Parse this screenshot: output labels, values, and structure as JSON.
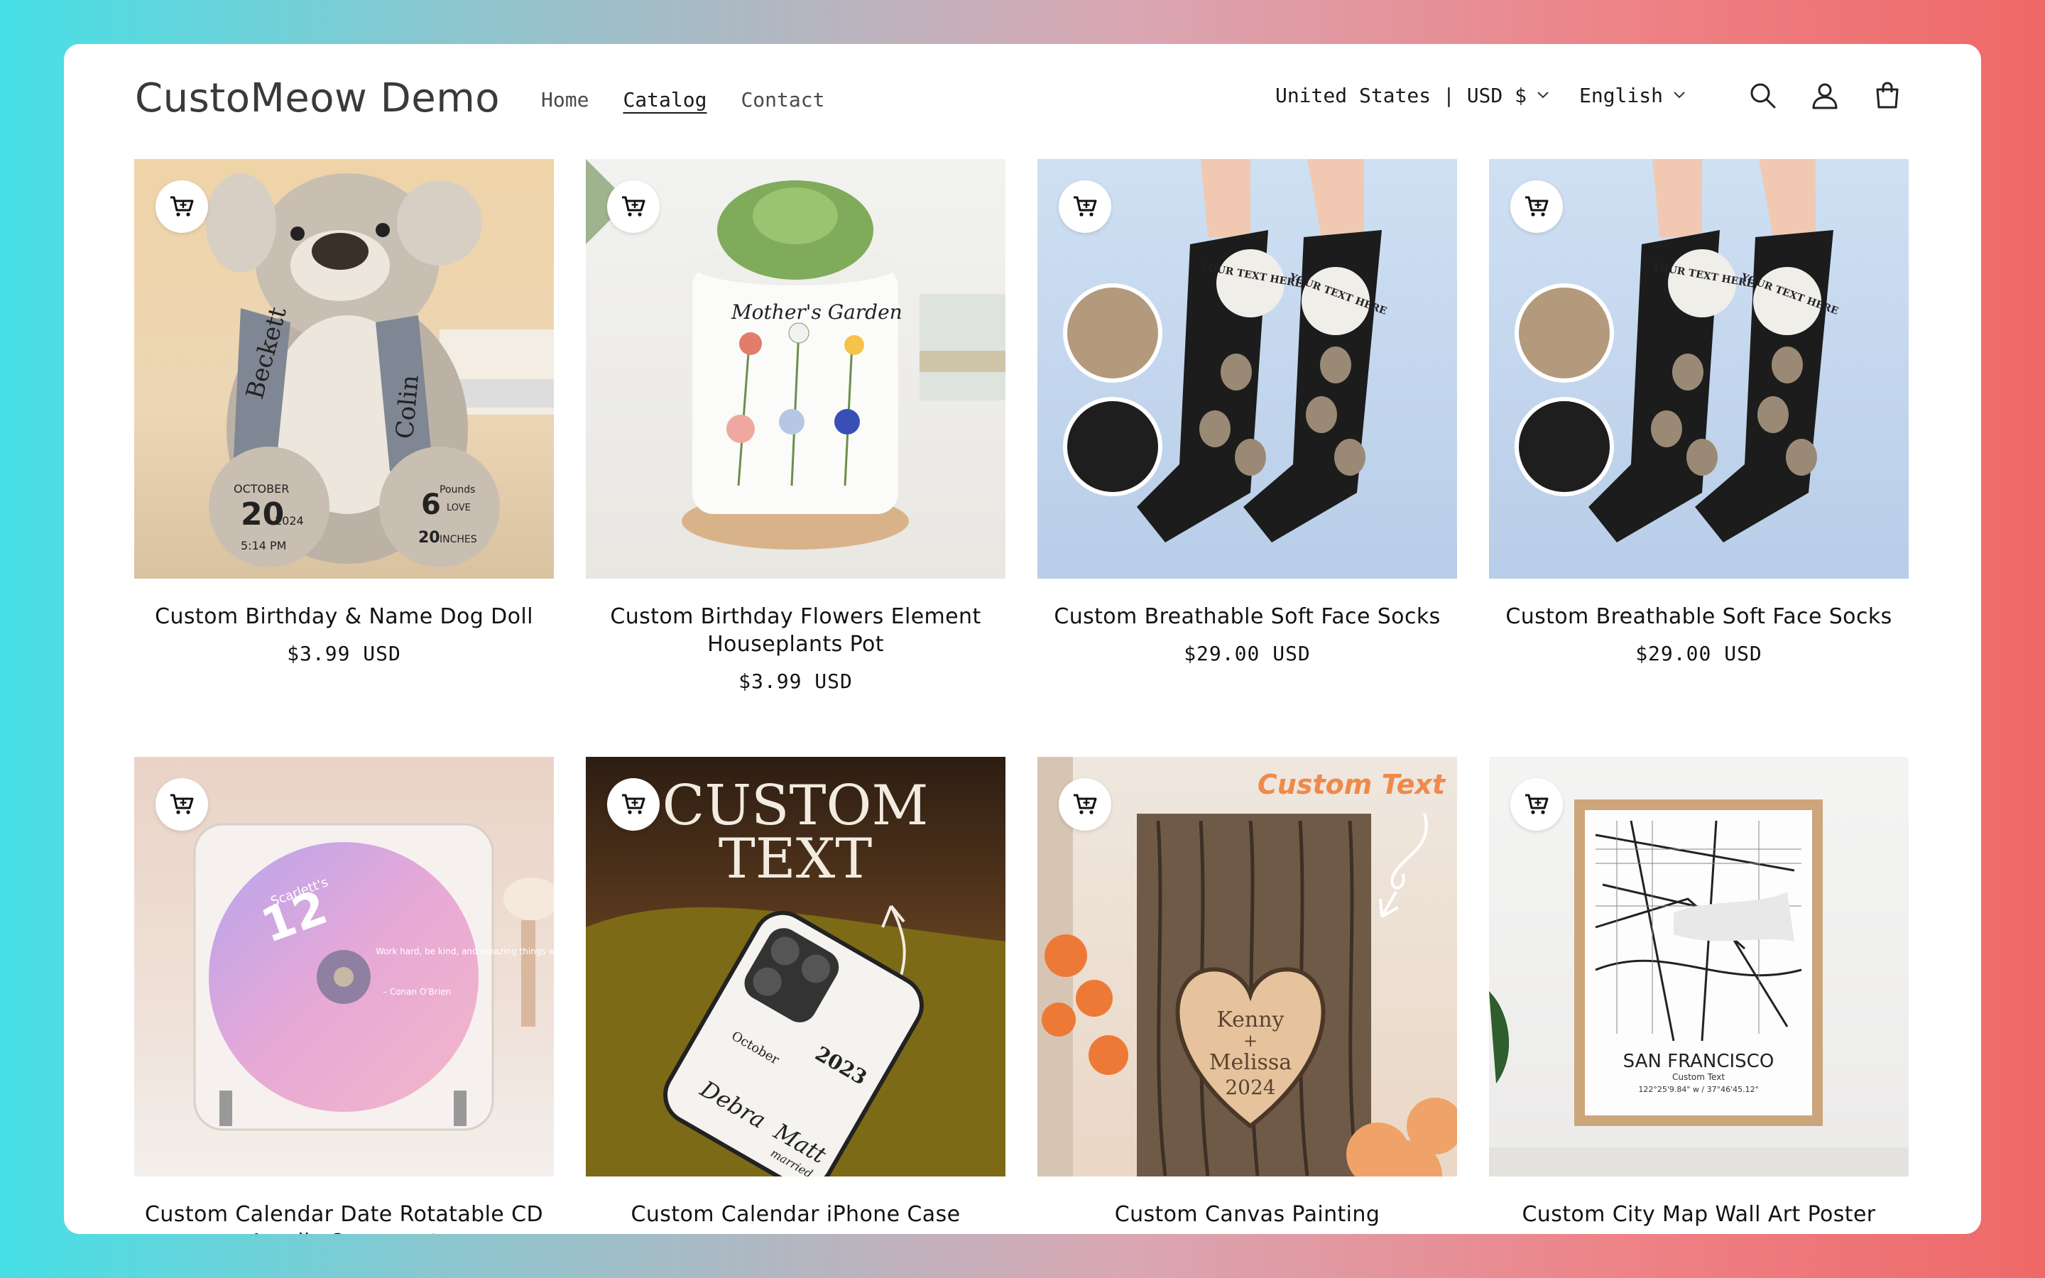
{
  "store": {
    "name": "CustoMeow Demo"
  },
  "nav": {
    "items": [
      {
        "label": "Home",
        "active": false
      },
      {
        "label": "Catalog",
        "active": true
      },
      {
        "label": "Contact",
        "active": false
      }
    ]
  },
  "header": {
    "country_currency": "United States | USD $",
    "language": "English",
    "icons": [
      "search-icon",
      "account-icon",
      "cart-icon"
    ]
  },
  "products": [
    {
      "title": "Custom Birthday & Name Dog Doll",
      "price": "$3.99 USD",
      "image_text": [
        "Beckett",
        "Colin",
        "OCTOBER",
        "20",
        "2024",
        "5:14 PM",
        "6",
        "Pounds",
        "LOVE",
        "20",
        "INCHES"
      ]
    },
    {
      "title": "Custom Birthday Flowers Element Houseplants Pot",
      "price": "$3.99 USD",
      "image_text": [
        "Mother's Garden"
      ]
    },
    {
      "title": "Custom Breathable Soft Face Socks",
      "price": "$29.00 USD",
      "image_text": [
        "YOUR TEXT HERE",
        "YOUR TEXT HERE"
      ]
    },
    {
      "title": "Custom Breathable Soft Face Socks",
      "price": "$29.00 USD",
      "image_text": [
        "YOUR TEXT HERE",
        "YOUR TEXT HERE"
      ]
    },
    {
      "title": "Custom Calendar Date Rotatable CD Acrylic Ornament",
      "price": "",
      "image_text": [
        "Scarlett's",
        "12",
        "Work hard, be kind, and amazing things will happen.",
        "– Conan O'Brien"
      ]
    },
    {
      "title": "Custom Calendar iPhone Case",
      "price": "",
      "image_text": [
        "CUSTOM",
        "TEXT",
        "2023",
        "October",
        "Debra",
        "Matt",
        "married"
      ]
    },
    {
      "title": "Custom Canvas Painting",
      "price": "",
      "image_text": [
        "Custom Text",
        "Kenny",
        "+",
        "Melissa",
        "2024"
      ]
    },
    {
      "title": "Custom City Map Wall Art Poster",
      "price": "",
      "image_text": [
        "SAN FRANCISCO",
        "Custom Text",
        "122°25'9.84\" w / 37°46'45.12\""
      ]
    }
  ],
  "colors": {
    "accent_text": "#121212",
    "gradient_left": "#45e0e6",
    "gradient_right": "#ef6868"
  }
}
